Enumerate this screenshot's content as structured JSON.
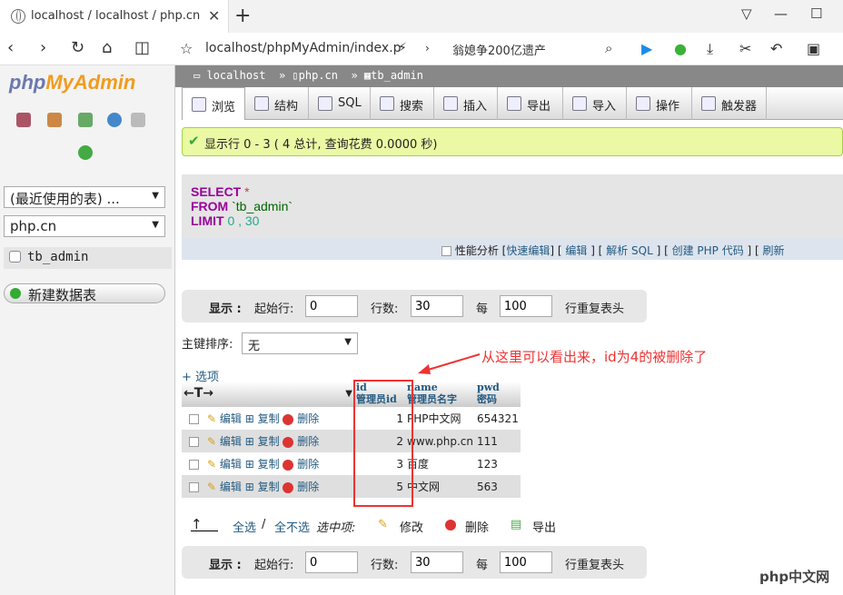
{
  "browser": {
    "tab_title": "localhost / localhost / php.cn / tb_",
    "url": "localhost/phpMyAdmin/index.p",
    "news": "翁媳争200亿遗产"
  },
  "left": {
    "logo_a": "php",
    "logo_b": "MyAdmin",
    "recent": "(最近使用的表) ...",
    "db": "php.cn",
    "table": "tb_admin",
    "new_table": "新建数据表"
  },
  "breadcrumb": {
    "server": "localhost",
    "db": "php.cn",
    "table": "tb_admin"
  },
  "menu": [
    "浏览",
    "结构",
    "SQL",
    "搜索",
    "插入",
    "导出",
    "导入",
    "操作",
    "触发器"
  ],
  "success": "显示行 0 - 3 ( 4 总计, 查询花费 0.0000 秒)",
  "sql": {
    "select": "SELECT",
    "star": "*",
    "from": "FROM",
    "table": "`tb_admin`",
    "limit": "LIMIT",
    "limit_vals": "0 , 30"
  },
  "sql_links": {
    "profiling": "性能分析",
    "quick_edit": "快速编辑",
    "edit": "编辑",
    "explain": "解析 SQL",
    "create_php": "创建 PHP 代码",
    "refresh": "刷新"
  },
  "nav": {
    "show": "显示 :",
    "start": "起始行:",
    "start_val": "0",
    "rows": "行数:",
    "rows_val": "30",
    "every": "每",
    "every_val": "100",
    "repeat": "行重复表头"
  },
  "sort": {
    "label": "主键排序:",
    "value": "无"
  },
  "options": "+ 选项",
  "columns": [
    {
      "name": "id",
      "comment": "管理员id"
    },
    {
      "name": "name",
      "comment": "管理员名字"
    },
    {
      "name": "pwd",
      "comment": "密码"
    }
  ],
  "row_actions": {
    "edit": "编辑",
    "copy": "复制",
    "delete": "删除"
  },
  "rows": [
    {
      "id": "1",
      "name": "PHP中文网",
      "pwd": "654321"
    },
    {
      "id": "2",
      "name": "www.php.cn",
      "pwd": "111"
    },
    {
      "id": "3",
      "name": "百度",
      "pwd": "123"
    },
    {
      "id": "5",
      "name": "中文网",
      "pwd": "563"
    }
  ],
  "annotation": "从这里可以看出来，id为4的被删除了",
  "bottom": {
    "check_all": "全选",
    "uncheck_all": "全不选",
    "selected": "选中项:",
    "edit": "修改",
    "delete": "删除",
    "export": "导出"
  },
  "watermark": "php中文网"
}
